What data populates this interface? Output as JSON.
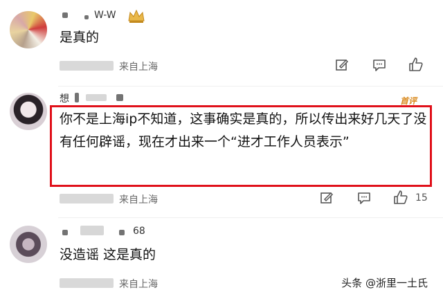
{
  "comments": [
    {
      "username_visible": "W-W",
      "text": "是真的",
      "location": "来自上海"
    },
    {
      "username_visible": "想",
      "badge": "首评",
      "text": "你不是上海ip不知道，这事确实是真的，所以传出来好几天了没有任何辟谣，现在才出来一个“进才工作人员表示”",
      "location": "来自上海",
      "like_count": "15"
    },
    {
      "username_visible": "68",
      "text": "没造谣 这是真的",
      "location": "来自上海"
    }
  ],
  "watermark": "头条 @浙里一土氏",
  "icons": [
    "edit-icon",
    "comment-icon",
    "like-icon",
    "crown-icon"
  ],
  "colors": {
    "highlight_border": "#e0101a",
    "badge": "#d98a1f",
    "meta_text": "#666666"
  }
}
